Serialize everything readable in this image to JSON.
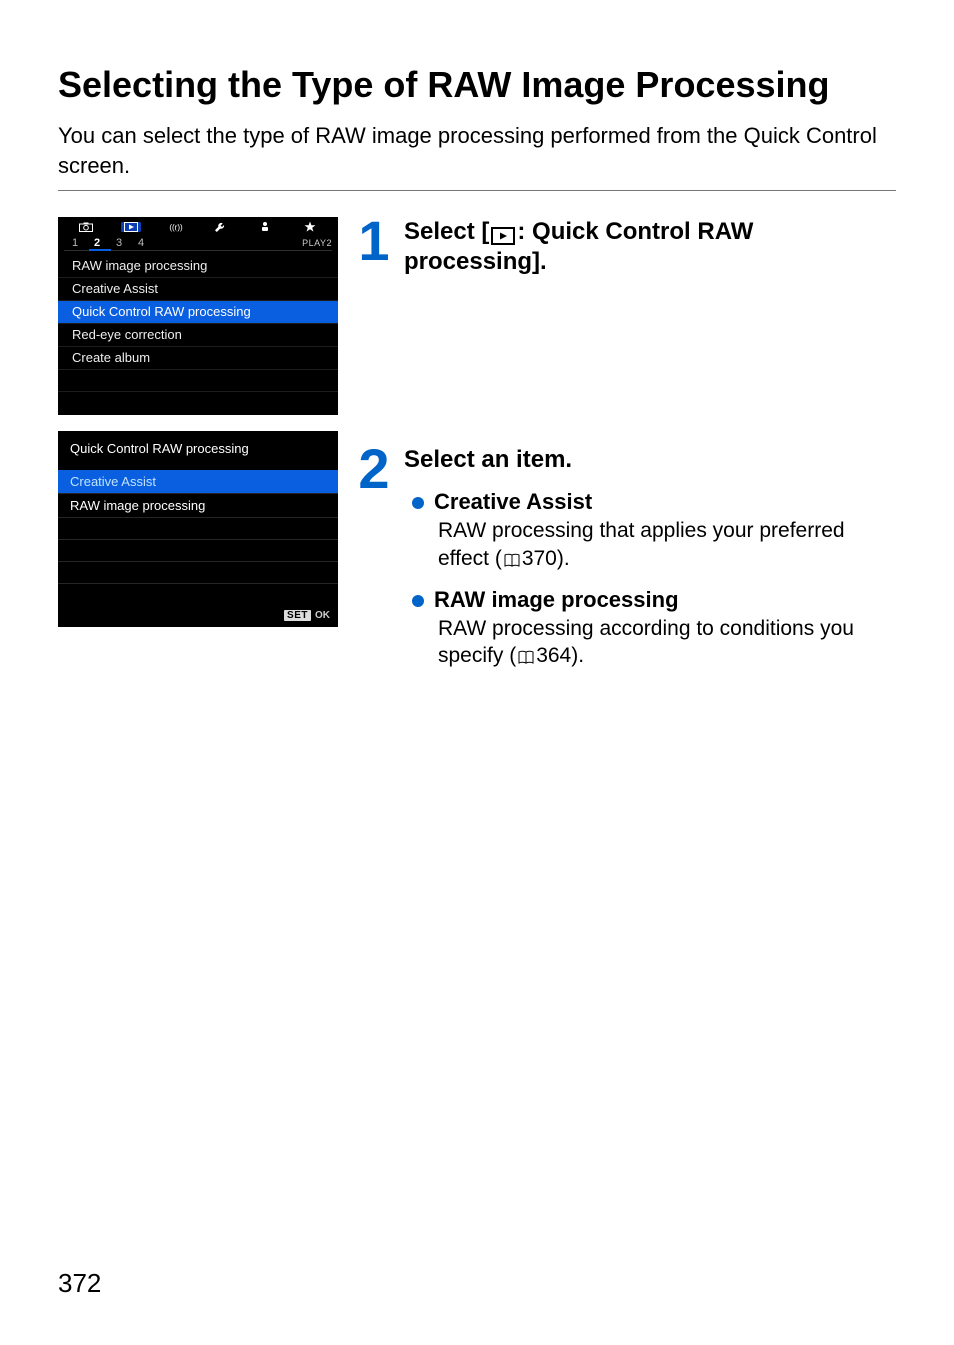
{
  "page": {
    "title": "Selecting the Type of RAW Image Processing",
    "intro": "You can select the type of RAW image processing performed from the Quick Control screen.",
    "page_number": "372"
  },
  "screen1": {
    "tabs": [
      "1",
      "2",
      "3",
      "4"
    ],
    "active_tab_index": 1,
    "tab_group_label": "PLAY2",
    "items": [
      {
        "label": "RAW image processing",
        "highlight": false
      },
      {
        "label": "Creative Assist",
        "highlight": false
      },
      {
        "label": "Quick Control RAW processing",
        "highlight": true
      },
      {
        "label": "Red-eye correction",
        "highlight": false
      },
      {
        "label": "Create album",
        "highlight": false
      }
    ]
  },
  "screen2": {
    "heading": "Quick Control RAW processing",
    "items": [
      {
        "label": "Creative Assist",
        "selected": true
      },
      {
        "label": "RAW image processing",
        "selected": false
      }
    ],
    "set_label": "SET",
    "ok_label": "OK"
  },
  "steps": {
    "one": {
      "num": "1",
      "prefix": "Select [",
      "suffix": ": Quick Control RAW processing]."
    },
    "two": {
      "num": "2",
      "heading": "Select an item.",
      "bullets": [
        {
          "title": "Creative Assist",
          "desc_before": "RAW processing that applies your preferred effect (",
          "page_ref": "370",
          "desc_after": ")."
        },
        {
          "title": "RAW image processing",
          "desc_before": "RAW processing according to conditions you specify (",
          "page_ref": "364",
          "desc_after": ")."
        }
      ]
    }
  }
}
